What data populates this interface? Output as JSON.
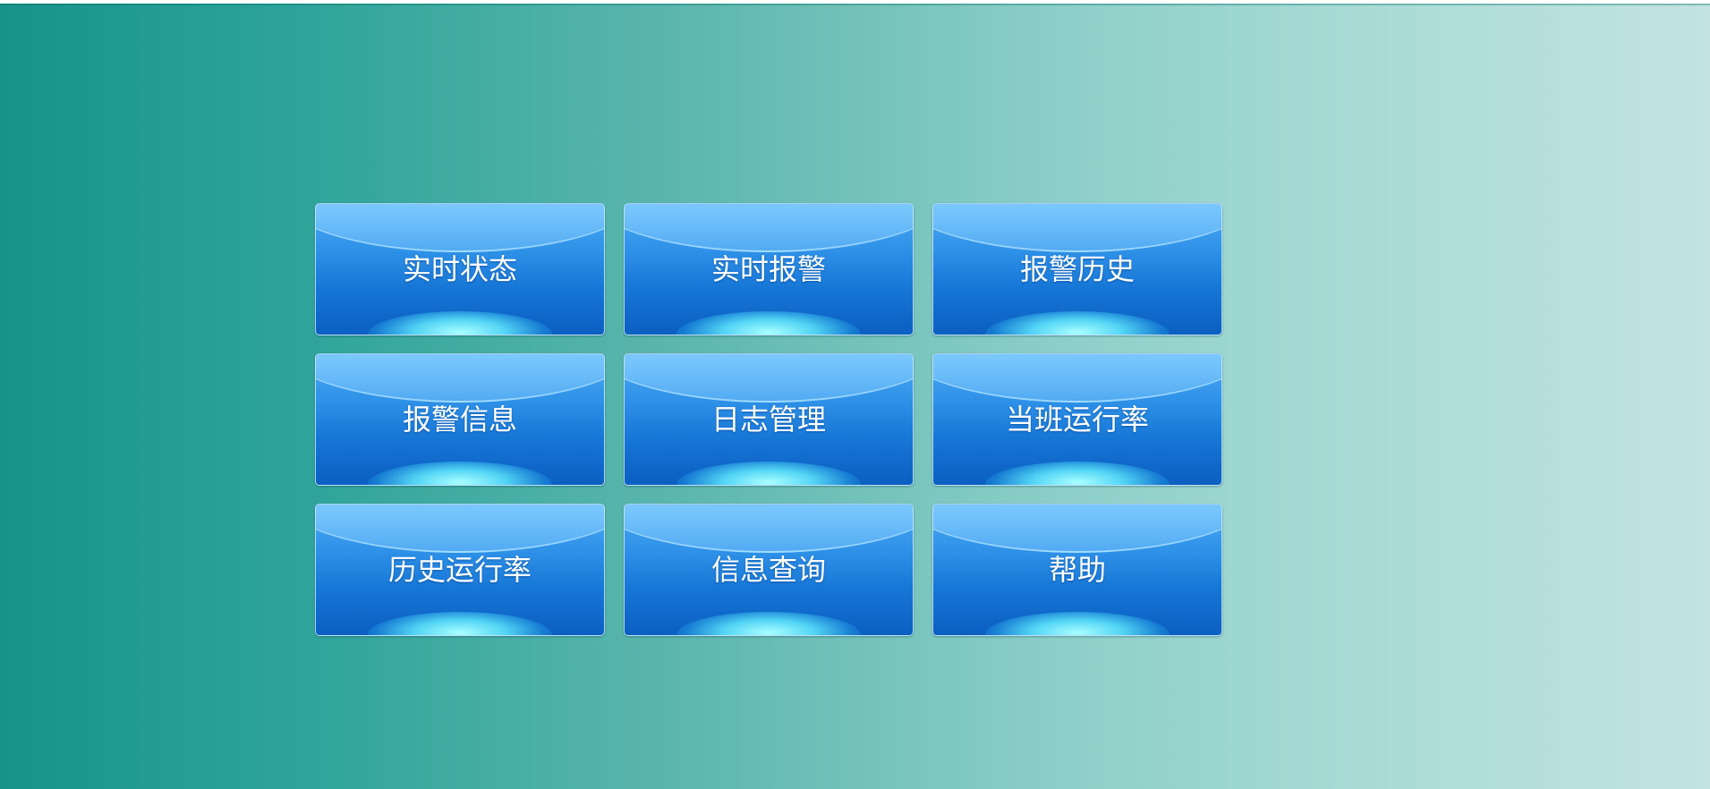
{
  "menu": {
    "tiles": [
      {
        "label": "实时状态"
      },
      {
        "label": "实时报警"
      },
      {
        "label": "报警历史"
      },
      {
        "label": "报警信息"
      },
      {
        "label": "日志管理"
      },
      {
        "label": "当班运行率"
      },
      {
        "label": "历史运行率"
      },
      {
        "label": "信息查询"
      },
      {
        "label": "帮助"
      }
    ]
  },
  "colors": {
    "background_left": "#16948a",
    "background_right": "#c2e3e1",
    "tile_top": "#4faaf2",
    "tile_bottom": "#0b5fc1",
    "tile_text": "#ffffff"
  }
}
